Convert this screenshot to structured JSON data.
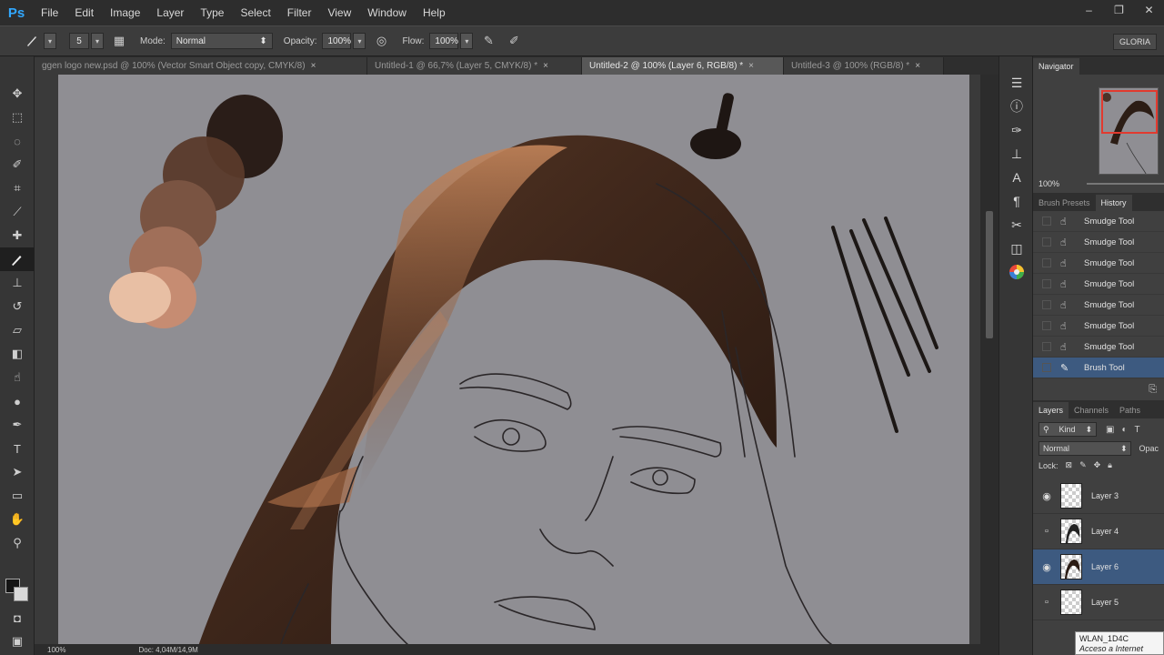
{
  "app": {
    "logo": "Ps"
  },
  "menu": [
    "File",
    "Edit",
    "Image",
    "Layer",
    "Type",
    "Select",
    "Filter",
    "View",
    "Window",
    "Help"
  ],
  "window_controls": [
    "–",
    "❐",
    "✕"
  ],
  "options": {
    "brush_size": "5",
    "mode_label": "Mode:",
    "mode_value": "Normal",
    "opacity_label": "Opacity:",
    "opacity_value": "100%",
    "flow_label": "Flow:",
    "flow_value": "100%",
    "workspace": "GLORIA"
  },
  "tabs": [
    {
      "label": "ggen logo new.psd @ 100% (Vector Smart Object copy, CMYK/8)",
      "active": false
    },
    {
      "label": "Untitled-1 @ 66,7% (Layer 5, CMYK/8) *",
      "active": false
    },
    {
      "label": "Untitled-2 @ 100% (Layer 6, RGB/8) *",
      "active": true
    },
    {
      "label": "Untitled-3 @ 100% (RGB/8) *",
      "active": false
    }
  ],
  "status": {
    "zoom": "100%",
    "doc": "Doc: 4,04M/14,9M"
  },
  "navigator": {
    "title": "Navigator",
    "zoom": "100%"
  },
  "history_panel": {
    "tabs": [
      "Brush Presets",
      "History"
    ],
    "items": [
      "Smudge Tool",
      "Smudge Tool",
      "Smudge Tool",
      "Smudge Tool",
      "Smudge Tool",
      "Smudge Tool",
      "Smudge Tool",
      "Brush Tool"
    ]
  },
  "layers_panel": {
    "tabs": [
      "Layers",
      "Channels",
      "Paths"
    ],
    "filter_label": "Kind",
    "blend_mode": "Normal",
    "opacity_label": "Opac",
    "lock_label": "Lock:",
    "layers": [
      {
        "name": "Layer 3",
        "visible": true,
        "selected": false
      },
      {
        "name": "Layer 4",
        "visible": false,
        "selected": false
      },
      {
        "name": "Layer 6",
        "visible": true,
        "selected": true
      },
      {
        "name": "Layer 5",
        "visible": false,
        "selected": false
      }
    ]
  },
  "tooltip": {
    "line1": "WLAN_1D4C",
    "line2": "Acceso a Internet"
  },
  "colors": {
    "canvas_bg": "#8f8e93",
    "hair_dark": "#3a2418",
    "hair_highlight": "#b8784a",
    "selection_blue": "#3d5a80",
    "nav_frame": "#e23a2f"
  }
}
